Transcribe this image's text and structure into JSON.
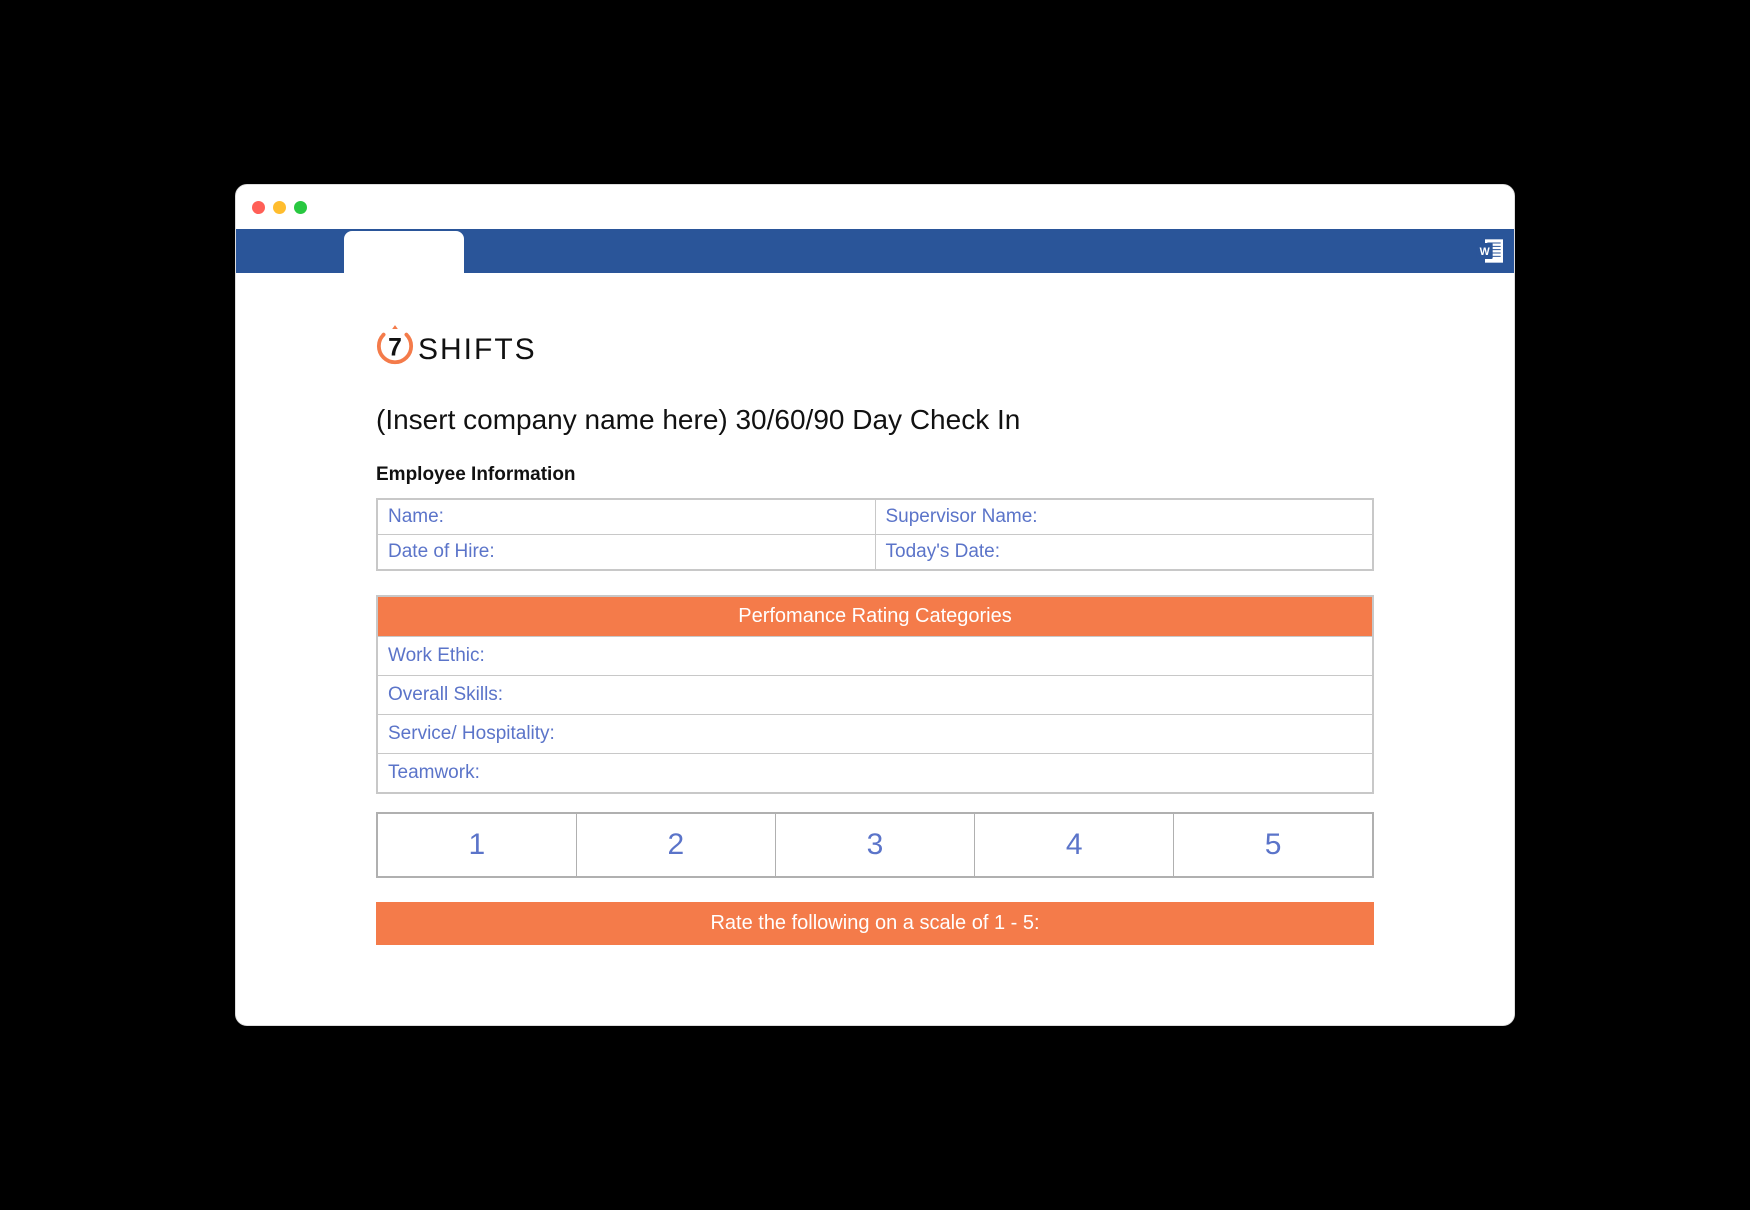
{
  "logo": {
    "text": "SHIFTS"
  },
  "title": "(Insert company name here) 30/60/90 Day Check In",
  "employee_info": {
    "heading": "Employee Information",
    "fields": {
      "name": "Name:",
      "supervisor": "Supervisor Name:",
      "hire_date": "Date of Hire:",
      "today": "Today's Date:"
    }
  },
  "performance": {
    "header": "Perfomance Rating Categories",
    "categories": [
      "Work Ethic:",
      "Overall Skills:",
      "Service/ Hospitality:",
      "Teamwork:"
    ]
  },
  "scale": {
    "values": [
      "1",
      "2",
      "3",
      "4",
      "5"
    ]
  },
  "rate_banner": "Rate the following on a scale of 1 - 5:",
  "colors": {
    "ribbon": "#2a5599",
    "accent": "#f47b4a",
    "field_text": "#5b74c9"
  }
}
